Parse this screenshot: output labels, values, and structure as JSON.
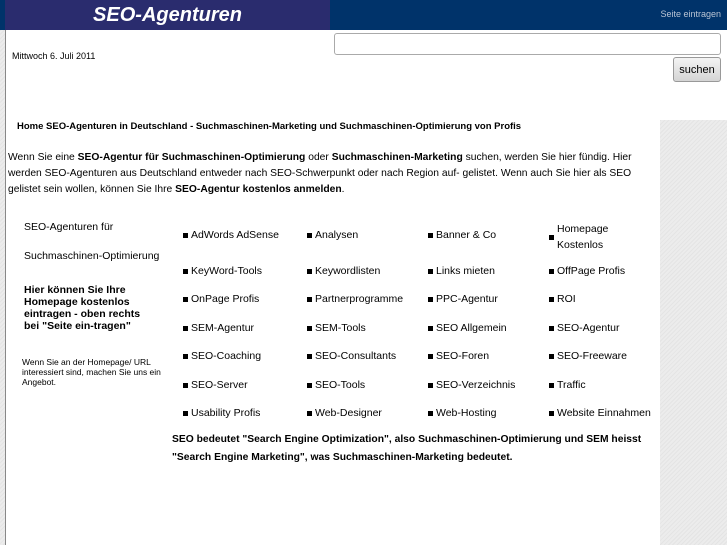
{
  "header": {
    "logo": "SEO-Agenturen",
    "seite_eintragen": "Seite eintragen"
  },
  "date": "Mittwoch 6. Juli 2011",
  "search": {
    "value": "",
    "button": "suchen"
  },
  "title": "Home SEO-Agenturen in Deutschland - Suchmaschinen-Marketing und Suchmaschinen-Optimierung von Profis",
  "intro": {
    "t1": "Wenn Sie eine ",
    "b1": "SEO-Agentur für Suchmaschinen-Optimierung",
    "t2": " oder ",
    "b2": "Suchmaschinen-Marketing",
    "t3": " suchen, werden Sie hier fündig. Hier werden SEO-Agenturen aus Deutschland entweder nach SEO-Schwerpunkt oder nach Region auf- gelistet. Wenn auch Sie hier als SEO gelistet sein wollen, können Sie Ihre ",
    "b3": "SEO-Agentur kostenlos anmelden",
    "t4": "."
  },
  "sidebar": {
    "line1": "SEO-Agenturen für",
    "line2": "Suchmaschinen-Optimierung",
    "bold": "Hier können Sie Ihre Homepage kostenlos eintragen - oben rechts bei \"Seite ein-tragen\"",
    "small": "Wenn Sie an der Homepage/ URL interessiert sind, machen Sie uns ein Angebot."
  },
  "links": [
    [
      "AdWords AdSense",
      "Analysen",
      "Banner & Co",
      "Homepage Kostenlos"
    ],
    [
      "KeyWord-Tools",
      "Keywordlisten",
      "Links mieten",
      "OffPage Profis"
    ],
    [
      "OnPage Profis",
      "Partnerprogramme",
      "PPC-Agentur",
      "ROI"
    ],
    [
      "SEM-Agentur",
      "SEM-Tools",
      "SEO Allgemein",
      "SEO-Agentur"
    ],
    [
      "SEO-Coaching",
      "SEO-Consultants",
      "SEO-Foren",
      "SEO-Freeware"
    ],
    [
      "SEO-Server",
      "SEO-Tools",
      "SEO-Verzeichnis",
      "Traffic"
    ],
    [
      "Usability Profis",
      "Web-Designer",
      "Web-Hosting",
      "Website Einnahmen"
    ]
  ],
  "seo_info": "SEO bedeutet \"Search Engine Optimization\", also Suchmaschinen-Optimierung und SEM heisst \"Search Engine Marketing\", was Suchmaschinen-Marketing bedeutet."
}
